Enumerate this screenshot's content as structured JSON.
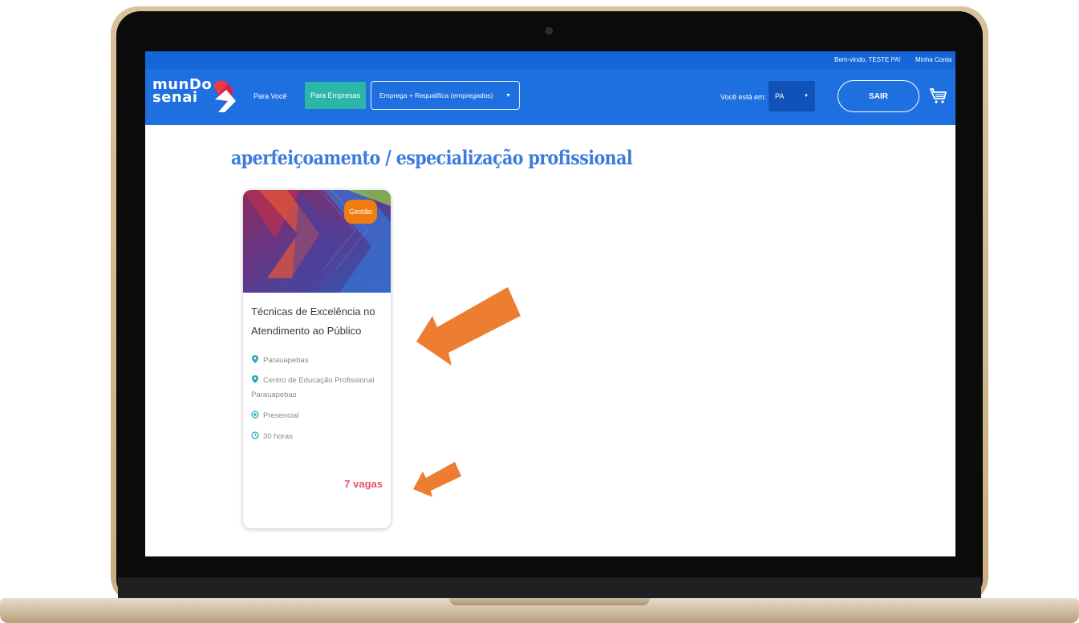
{
  "topbar": {
    "welcome": "Bem-vindo, TESTE PA!",
    "account": "Minha Conta"
  },
  "header": {
    "logo_line1": "munDo",
    "logo_line2": "senai",
    "nav_para_voce": "Para Você",
    "nav_para_empresas": "Para Empresas",
    "programa_select": "Emprega + Requalifica (empregados)",
    "estado_label": "Você está em:",
    "estado_select": "PA",
    "sair_label": "SAIR",
    "icons": {
      "cart": "shopping-cart-icon",
      "dropdown": "caret-down-icon"
    }
  },
  "main": {
    "title": "aperfeiçoamento / especialização profissional"
  },
  "course_card": {
    "category_badge": "Gestão",
    "title": "Técnicas de Excelência no Atendimento ao Público",
    "city": "Parauapebas",
    "school": "Centro de Educação Profissional Parauapebas",
    "modality": "Presencial",
    "duration": "30 horas",
    "vacancies": "7 vagas"
  },
  "colors": {
    "header_blue": "#1e6fe0",
    "title_blue": "#3c7bdc",
    "badge_orange": "#f07c12",
    "teal": "#2bb6a8",
    "vagas_pink": "#ea4e6b",
    "annotation_arrow": "#ed7d31"
  }
}
